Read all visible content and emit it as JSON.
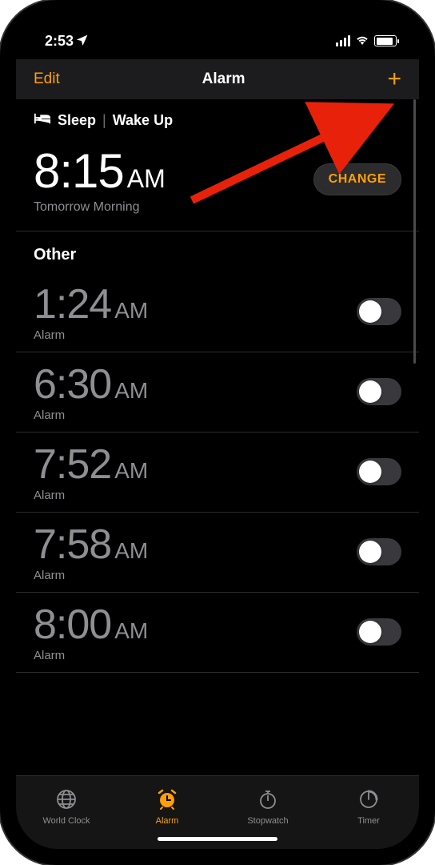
{
  "statusbar": {
    "time": "2:53"
  },
  "navbar": {
    "edit": "Edit",
    "title": "Alarm",
    "add": "+"
  },
  "sleep": {
    "header_sleep": "Sleep",
    "header_sep": "|",
    "header_wake": "Wake Up",
    "time": "8:15",
    "ampm": "AM",
    "subtitle": "Tomorrow Morning",
    "change": "CHANGE"
  },
  "other": {
    "title": "Other",
    "alarms": [
      {
        "time": "1:24",
        "ampm": "AM",
        "label": "Alarm",
        "on": false
      },
      {
        "time": "6:30",
        "ampm": "AM",
        "label": "Alarm",
        "on": false
      },
      {
        "time": "7:52",
        "ampm": "AM",
        "label": "Alarm",
        "on": false
      },
      {
        "time": "7:58",
        "ampm": "AM",
        "label": "Alarm",
        "on": false
      },
      {
        "time": "8:00",
        "ampm": "AM",
        "label": "Alarm",
        "on": false
      }
    ]
  },
  "tabs": {
    "worldclock": "World Clock",
    "alarm": "Alarm",
    "stopwatch": "Stopwatch",
    "timer": "Timer"
  },
  "colors": {
    "accent": "#ff9f0a",
    "bg": "#000000",
    "secondary": "#8e8e93"
  }
}
